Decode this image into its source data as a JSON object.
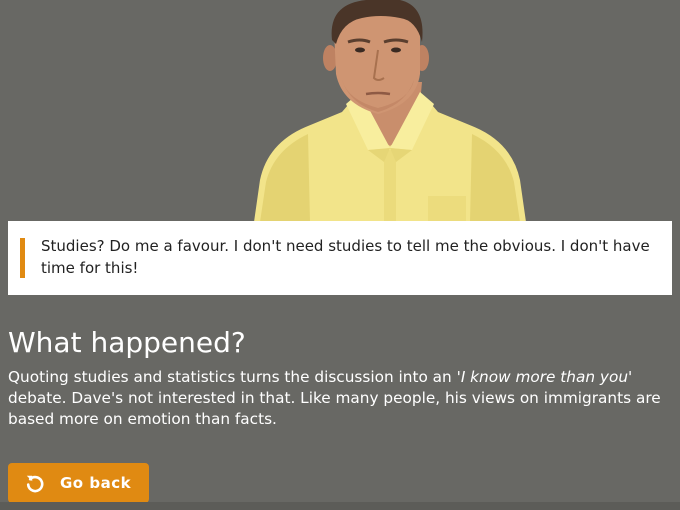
{
  "scene": {
    "character_image": "man-in-yellow-shirt",
    "quote": "Studies? Do me a favour. I don't need studies to tell me the obvious. I don't have time for this!"
  },
  "explanation": {
    "heading": "What happened?",
    "body_before": "Quoting studies and statistics turns the discussion into an '",
    "body_em": "I know more than you",
    "body_after": "' debate. Dave's not interested in that. Like many people, his views on immigrants are based more on emotion than facts."
  },
  "actions": {
    "go_back_label": "Go back",
    "go_back_icon": "undo-arrow-icon"
  },
  "colors": {
    "background": "#686864",
    "accent": "#e08a12",
    "card": "#ffffff"
  }
}
